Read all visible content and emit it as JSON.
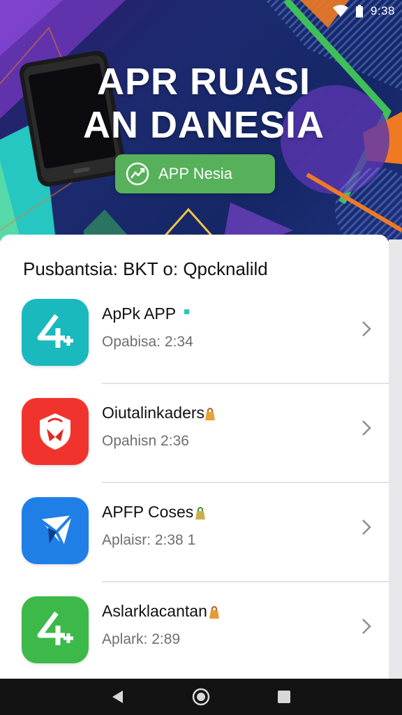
{
  "status_bar": {
    "time": "9:38",
    "wifi_icon": "wifi-icon",
    "battery_icon": "battery-icon"
  },
  "banner": {
    "title_line1": "APR RUASI",
    "title_line2": "AN DANESIA",
    "cta_label": "APP Nesia",
    "cta_icon": "trend-arrow-icon",
    "colors": {
      "accent_green": "#56b15a",
      "orange": "#f07a22",
      "teal": "#25c7c0",
      "bg_dark": "#1b2a6e"
    }
  },
  "section": {
    "title": "Pusbantsia: BKT o: Qpcknalild"
  },
  "apps": [
    {
      "name": "ApPk APP",
      "sub": "Opabisa: 2:34",
      "icon": "app-icon-teal",
      "color": "#1ab9bd",
      "badge": "dot"
    },
    {
      "name": "Oiutalinkaders",
      "sub": "Opahisn 2:36",
      "icon": "app-icon-red",
      "color": "#f0342d",
      "badge": "bag"
    },
    {
      "name": "APFP Coses",
      "sub": "Aplaisr: 2:38 1",
      "icon": "app-icon-blue",
      "color": "#1f7fe6",
      "badge": "bag"
    },
    {
      "name": "Aslarklacantan",
      "sub": "Aplark: 2:89",
      "icon": "app-icon-green",
      "color": "#3db94a",
      "badge": "bag"
    }
  ],
  "nav": {
    "back": "back-icon",
    "home": "home-icon",
    "recents": "recents-icon"
  }
}
